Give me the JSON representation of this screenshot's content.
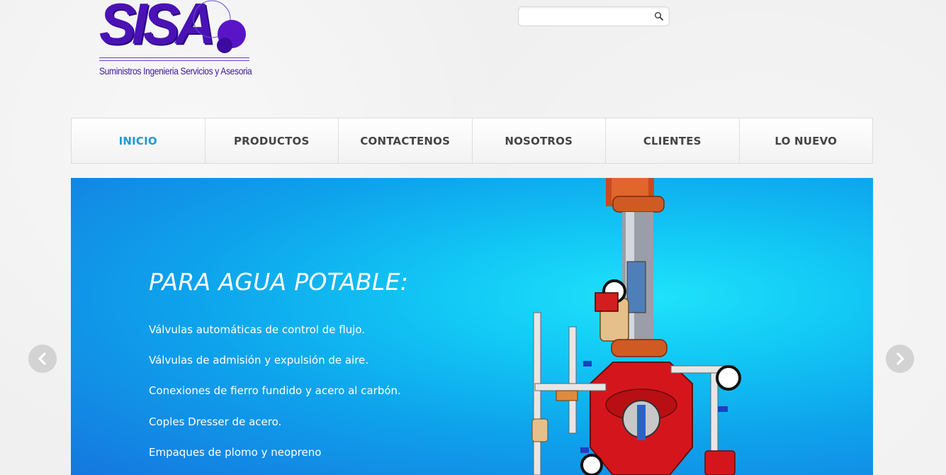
{
  "logo": {
    "text": "SISA",
    "subtitle": "Suministros Ingenieria Servicios y Asesoria",
    "color": "#4a12b5"
  },
  "search": {
    "placeholder": "",
    "value": "",
    "icon": "search-icon"
  },
  "nav": {
    "items": [
      {
        "label": "INICIO",
        "active": true
      },
      {
        "label": "PRODUCTOS",
        "active": false
      },
      {
        "label": "CONTACTENOS",
        "active": false
      },
      {
        "label": "NOSOTROS",
        "active": false
      },
      {
        "label": "CLIENTES",
        "active": false
      },
      {
        "label": "LO NUEVO",
        "active": false
      }
    ],
    "active_color": "#1d9ad6"
  },
  "slide": {
    "title": "PARA AGUA POTABLE:",
    "lines": [
      "Válvulas automáticas de control de flujo.",
      "Válvulas de admisión y expulsión de aire.",
      "Conexiones de fierro fundido y acero al carbón.",
      "Coples Dresser de acero.",
      "Empaques de plomo y neopreno"
    ],
    "prev_icon": "chevron-left-icon",
    "next_icon": "chevron-right-icon"
  }
}
